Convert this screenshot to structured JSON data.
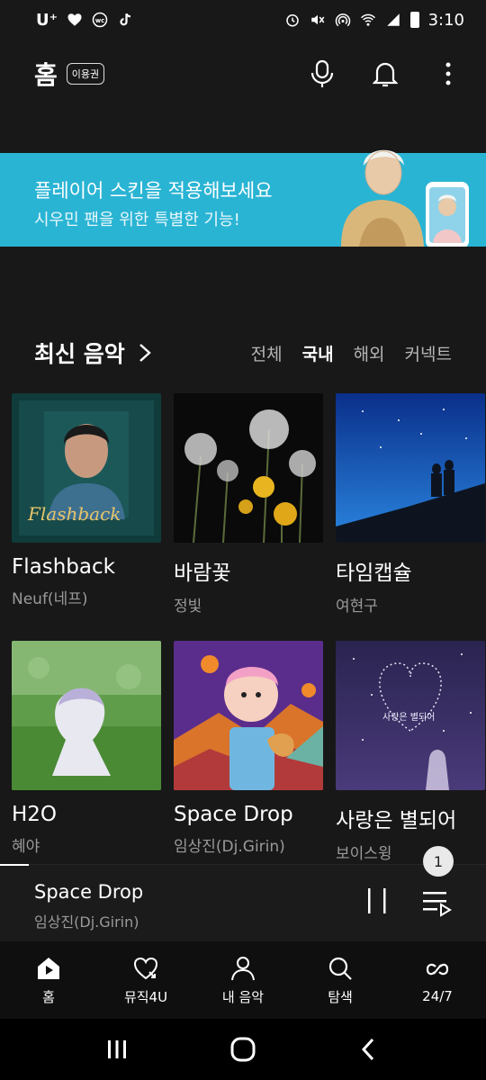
{
  "status_bar": {
    "carrier": "U⁺",
    "time": "3:10",
    "left_icons": [
      "heart-icon",
      "wc-icon",
      "tiktok-icon"
    ],
    "right_icons": [
      "alarm-icon",
      "mute-icon",
      "hotspot-icon",
      "wifi-icon",
      "signal-icon",
      "battery-icon"
    ]
  },
  "header": {
    "title": "홈",
    "pass_badge": "이용권",
    "actions": [
      "mic-icon",
      "bell-icon",
      "more-vert-icon"
    ]
  },
  "banner": {
    "title": "플레이어 스킨을 적용해보세요",
    "subtitle": "시우민 팬을 위한 특별한 기능!",
    "color": "#2ab4d4"
  },
  "section": {
    "title": "최신 음악",
    "filters": [
      {
        "label": "전체",
        "active": false
      },
      {
        "label": "국내",
        "active": true
      },
      {
        "label": "해외",
        "active": false
      },
      {
        "label": "커넥트",
        "active": false
      }
    ]
  },
  "albums": [
    {
      "title": "Flashback",
      "artist": "Neuf(네프)",
      "cover_text": "Flashback"
    },
    {
      "title": "바람꽃",
      "artist": "정빛",
      "cover_text": ""
    },
    {
      "title": "타임캡슐",
      "artist": "여현구",
      "cover_text": ""
    },
    {
      "title": "H2O",
      "artist": "혜야",
      "cover_text": ""
    },
    {
      "title": "Space Drop",
      "artist": "임상진(Dj.Girin)",
      "cover_text": ""
    },
    {
      "title": "사랑은 별되어",
      "artist": "보이스윙",
      "cover_text": "사랑은 별되어"
    }
  ],
  "mini_player": {
    "title": "Space Drop",
    "artist": "임상진(Dj.Girin)",
    "queue_count": "1",
    "progress": 0.06
  },
  "bottom_nav": [
    {
      "label": "홈",
      "icon": "home-icon"
    },
    {
      "label": "뮤직4U",
      "icon": "heart-music-icon"
    },
    {
      "label": "내 음악",
      "icon": "person-icon"
    },
    {
      "label": "탐색",
      "icon": "search-icon"
    },
    {
      "label": "24/7",
      "icon": "link-loop-icon"
    }
  ]
}
